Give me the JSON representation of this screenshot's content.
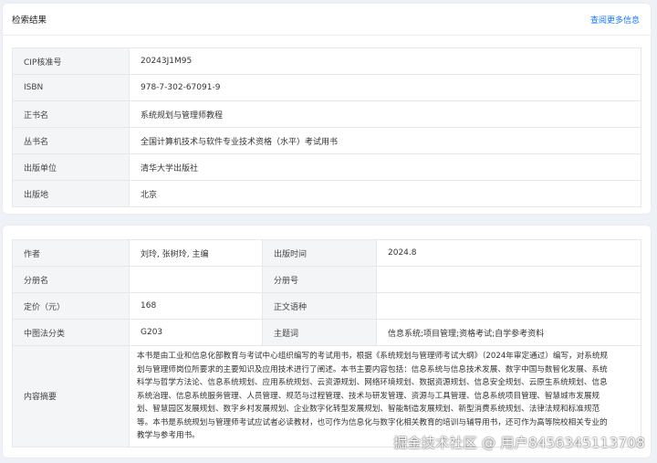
{
  "header": {
    "title": "检索结果",
    "more_link": "查阅更多信息"
  },
  "basic_info": [
    {
      "label": "CIP核准号",
      "value": "20243J1M95"
    },
    {
      "label": "ISBN",
      "value": "978-7-302-67091-9"
    },
    {
      "label": "正书名",
      "value": "系统规划与管理师教程"
    },
    {
      "label": "丛书名",
      "value": "全国计算机技术与软件专业技术资格（水平）考试用书"
    },
    {
      "label": "出版单位",
      "value": "清华大学出版社"
    },
    {
      "label": "出版地",
      "value": "北京"
    }
  ],
  "details": {
    "author": {
      "label": "作者",
      "value": "刘玲, 张树玲, 主编"
    },
    "pub_date": {
      "label": "出版时间",
      "value": "2024.8"
    },
    "part_title": {
      "label": "分册名",
      "value": ""
    },
    "part_no": {
      "label": "分册号",
      "value": ""
    },
    "price": {
      "label": "定价（元）",
      "value": "168"
    },
    "language": {
      "label": "正文语种",
      "value": ""
    },
    "clc": {
      "label": "中图法分类",
      "value": "G203"
    },
    "subject": {
      "label": "主题词",
      "value": "信息系统;项目管理;资格考试;自学参考资料"
    },
    "summary": {
      "label": "内容摘要",
      "lines": [
        "本书是由工业和信息化部教育与考试中心组织编写的考试用书，根据《系统规划与管理师考试大纲》（2024年审定通过）编写，对系统规",
        "划与管理师岗位所要求的主要知识及应用技术进行了阐述。本书主要内容包括：信息系统与信息技术发展、数字中国与数智化发展、系统",
        "科学与哲学方法论、信息系统规划、应用系统规划、云资源规划、网络环境规划、数据资源规划、信息安全规划、云原生系统规划、信息",
        "系统治理、信息系统服务管理、人员管理、规范与过程管理、技术与研发管理、资源与工具管理、信息系统项目管理、智慧城市发展规",
        "划、智慧园区发展规划、数字乡村发展规划、企业数字化转型发展规划、智能制造发展规划、新型消费系统规划、法律法规和标准规范",
        "等。本书是系统规划与管理师考试应试者必读教材，也可作为信息化与数字化相关教育的培训与辅导用书，还可作为高等院校相关专业的",
        "教学与参考用书。"
      ]
    }
  },
  "watermark": "掘金技术社区 @ 用户8456345113708"
}
